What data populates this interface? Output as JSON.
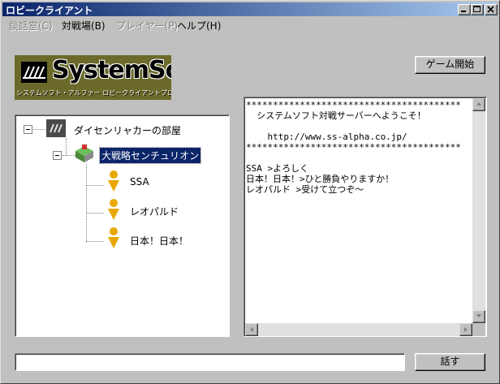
{
  "window": {
    "title": "ロビークライアント"
  },
  "menu": [
    {
      "label": "談話室(C)",
      "enabled": false
    },
    {
      "label": "対戦場(B)",
      "enabled": true
    },
    {
      "label": "プレイヤー(P)",
      "enabled": false
    },
    {
      "label": "ヘルプ(H)",
      "enabled": true
    }
  ],
  "logo": {
    "brand": "SystemSoft",
    "tagline": "システムソフト・アルファー ロビークライアントプログラム"
  },
  "buttons": {
    "start_game": "ゲーム開始",
    "talk": "話す"
  },
  "tree": {
    "room": "ダイセンリャカーの部屋",
    "game": "大戦略センチュリオン",
    "players": [
      "SSA",
      "レオパルド",
      "日本！日本！"
    ]
  },
  "chat": {
    "lines": [
      "****************************************",
      "  システムソフト対戦サーバーへようこそ！",
      "",
      "    http://www.ss-alpha.co.jp/",
      "****************************************",
      "",
      "SSA >よろしく",
      "日本！日本！>ひと勝負やりますか！",
      "レオパルド >受けて立つぞ～"
    ]
  },
  "input": {
    "value": ""
  },
  "colors": {
    "selection": "#0a246a",
    "titlebar_start": "#0a246a",
    "titlebar_end": "#a6caf0",
    "face": "#c0c0c0"
  }
}
